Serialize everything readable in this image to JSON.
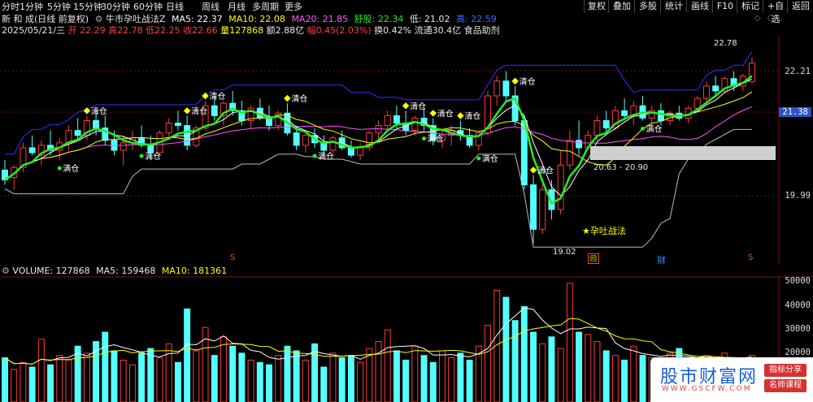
{
  "toolbar": {
    "periods": [
      "分时",
      "1分钟",
      "5分钟",
      "15分钟",
      "30分钟",
      "60分钟",
      "日线",
      "周线",
      "月线",
      "多周期",
      "更多"
    ],
    "active_period": "日线",
    "right_buttons": [
      "复权",
      "叠加",
      "多股",
      "统计",
      "画线",
      "F10",
      "标记",
      "+自选",
      "返回"
    ]
  },
  "stock": {
    "name": "新 和 成(日线 前复权)",
    "indicator": "牛市孕吐战法Z",
    "ma5": "MA5: 22.37",
    "ma10": "MA10: 22.08",
    "ma20": "MA20: 21.85",
    "sell": "舒股: 22.34",
    "low_label": "低: 21.02",
    "high_label": "高: 22.59"
  },
  "day_info": {
    "date": "2025/05/21/三",
    "open": "开 22.29",
    "high": "高22.78",
    "low": "低22.25",
    "close": "收22.66",
    "volume": "量127868",
    "amount": "额2.88亿",
    "change": "幅0.45(2.03%)",
    "turnover": "换0.42%",
    "float": "流通30.4亿",
    "sector": "食品助剂"
  },
  "price_axis": {
    "labels": [
      "22.21",
      "21.38",
      "19.99"
    ],
    "current": "21.38"
  },
  "annotations": {
    "high_mark": "22.78",
    "low_mark": "19.02",
    "range": "20.63 - 20.90",
    "pattern": "孕吐战法",
    "signal_sell": "清仓",
    "signal_buy": "满仓",
    "event_fin": "财",
    "event_s": "S"
  },
  "volume_panel": {
    "title": "VOLUME: 127868",
    "ma5": "MA5: 159468",
    "ma10": "MA10: 181361",
    "axis": [
      "50000",
      "40000",
      "30000",
      "20000"
    ]
  },
  "watermark": {
    "main": "股市财富网",
    "url": "WWW.GSCFW.COM",
    "tag1": "指标分享",
    "tag2": "名师课程"
  },
  "colors": {
    "up": "#ff3b3b",
    "down": "#54ffff",
    "ma5": "#ffffff",
    "ma10": "#ffff00",
    "ma20": "#ff55ff",
    "trend": "#22ee22",
    "band": "#3030ff",
    "signal": "#ffff00"
  },
  "chart_data": {
    "type": "candlestick",
    "volume_scale_ylim": [
      0,
      52000
    ],
    "price_ylim": [
      18.6,
      23.2
    ],
    "candles": [
      [
        20.5,
        20.7,
        20.2,
        20.3
      ],
      [
        20.35,
        20.6,
        20.1,
        20.55
      ],
      [
        20.55,
        21.05,
        20.45,
        20.95
      ],
      [
        20.95,
        21.2,
        20.8,
        20.85
      ],
      [
        20.8,
        21.1,
        20.6,
        21.0
      ],
      [
        21.0,
        21.3,
        20.8,
        20.9
      ],
      [
        20.9,
        21.15,
        20.7,
        21.05
      ],
      [
        21.05,
        21.4,
        20.9,
        21.3
      ],
      [
        21.3,
        21.55,
        21.1,
        21.2
      ],
      [
        21.2,
        21.6,
        21.1,
        21.5
      ],
      [
        21.5,
        21.7,
        21.2,
        21.35
      ],
      [
        21.35,
        21.6,
        21.0,
        21.1
      ],
      [
        21.1,
        21.3,
        20.8,
        20.9
      ],
      [
        20.9,
        21.2,
        20.6,
        21.05
      ],
      [
        21.05,
        21.3,
        20.9,
        21.15
      ],
      [
        21.15,
        21.4,
        20.95,
        21.0
      ],
      [
        21.0,
        21.2,
        20.7,
        20.85
      ],
      [
        20.85,
        21.3,
        20.8,
        21.25
      ],
      [
        21.25,
        21.55,
        21.1,
        21.45
      ],
      [
        21.45,
        21.7,
        21.3,
        21.4
      ],
      [
        21.4,
        21.6,
        20.9,
        21.0
      ],
      [
        21.0,
        21.4,
        20.95,
        21.35
      ],
      [
        21.35,
        21.9,
        21.3,
        21.8
      ],
      [
        21.8,
        22.0,
        21.5,
        21.6
      ],
      [
        21.6,
        21.9,
        21.4,
        21.85
      ],
      [
        21.85,
        22.1,
        21.6,
        21.7
      ],
      [
        21.7,
        21.9,
        21.4,
        21.5
      ],
      [
        21.5,
        21.8,
        21.35,
        21.75
      ],
      [
        21.75,
        21.95,
        21.5,
        21.55
      ],
      [
        21.55,
        21.8,
        21.3,
        21.4
      ],
      [
        21.4,
        21.7,
        21.3,
        21.65
      ],
      [
        21.65,
        21.85,
        21.2,
        21.25
      ],
      [
        21.25,
        21.4,
        20.9,
        21.0
      ],
      [
        21.0,
        21.3,
        20.85,
        21.2
      ],
      [
        21.2,
        21.35,
        20.95,
        21.05
      ],
      [
        21.05,
        21.2,
        20.8,
        20.9
      ],
      [
        20.9,
        21.2,
        20.85,
        21.15
      ],
      [
        21.15,
        21.3,
        20.9,
        20.95
      ],
      [
        20.95,
        21.1,
        20.75,
        20.8
      ],
      [
        20.8,
        21.05,
        20.7,
        20.95
      ],
      [
        20.95,
        21.3,
        20.9,
        21.25
      ],
      [
        21.25,
        21.5,
        21.1,
        21.4
      ],
      [
        21.4,
        21.7,
        21.3,
        21.6
      ],
      [
        21.6,
        21.8,
        21.35,
        21.45
      ],
      [
        21.45,
        21.7,
        21.2,
        21.3
      ],
      [
        21.3,
        21.6,
        21.2,
        21.55
      ],
      [
        21.55,
        21.75,
        21.3,
        21.4
      ],
      [
        21.4,
        21.55,
        21.0,
        21.1
      ],
      [
        21.1,
        21.3,
        20.95,
        21.2
      ],
      [
        21.2,
        21.4,
        21.0,
        21.3
      ],
      [
        21.3,
        21.5,
        21.1,
        21.2
      ],
      [
        21.2,
        21.35,
        20.95,
        21.0
      ],
      [
        21.0,
        21.3,
        20.9,
        21.25
      ],
      [
        21.25,
        22.1,
        21.2,
        22.0
      ],
      [
        22.0,
        22.4,
        21.8,
        22.3
      ],
      [
        22.3,
        22.5,
        21.9,
        22.0
      ],
      [
        22.0,
        22.2,
        21.4,
        21.5
      ],
      [
        21.5,
        21.6,
        20.1,
        20.2
      ],
      [
        20.2,
        20.4,
        19.02,
        19.3
      ],
      [
        19.3,
        20.3,
        19.2,
        20.1
      ],
      [
        20.1,
        20.3,
        19.5,
        19.7
      ],
      [
        19.7,
        20.9,
        19.6,
        20.6
      ],
      [
        20.6,
        21.3,
        20.5,
        21.1
      ],
      [
        21.1,
        21.5,
        20.8,
        20.95
      ],
      [
        20.95,
        21.3,
        20.9,
        21.2
      ],
      [
        21.2,
        21.6,
        21.1,
        21.5
      ],
      [
        21.5,
        21.7,
        21.2,
        21.35
      ],
      [
        21.35,
        21.8,
        21.3,
        21.7
      ],
      [
        21.7,
        21.95,
        21.5,
        21.6
      ],
      [
        21.6,
        21.9,
        21.4,
        21.8
      ],
      [
        21.8,
        22.0,
        21.5,
        21.55
      ],
      [
        21.55,
        21.8,
        21.4,
        21.7
      ],
      [
        21.7,
        21.85,
        21.4,
        21.5
      ],
      [
        21.5,
        21.7,
        21.4,
        21.65
      ],
      [
        21.65,
        21.8,
        21.5,
        21.55
      ],
      [
        21.55,
        21.8,
        21.45,
        21.75
      ],
      [
        21.75,
        22.0,
        21.7,
        21.95
      ],
      [
        21.95,
        22.3,
        21.9,
        22.2
      ],
      [
        22.2,
        22.4,
        22.0,
        22.1
      ],
      [
        22.1,
        22.4,
        22.05,
        22.35
      ],
      [
        22.35,
        22.5,
        22.1,
        22.2
      ],
      [
        22.2,
        22.45,
        22.1,
        22.4
      ],
      [
        22.29,
        22.78,
        22.25,
        22.66
      ]
    ],
    "volumes": [
      19000,
      14000,
      17000,
      15000,
      27000,
      16000,
      20000,
      18000,
      24000,
      21000,
      26000,
      30000,
      22000,
      18000,
      16000,
      21000,
      23000,
      19000,
      25000,
      17000,
      40000,
      22000,
      32000,
      20000,
      28000,
      24000,
      21000,
      18000,
      17000,
      16000,
      20000,
      24000,
      22000,
      18000,
      25000,
      15000,
      21000,
      19000,
      20000,
      17000,
      23000,
      26000,
      31000,
      22000,
      18000,
      24000,
      20000,
      17000,
      22000,
      19000,
      21000,
      18000,
      24000,
      33000,
      48000,
      45000,
      35000,
      41000,
      30000,
      25000,
      28000,
      23000,
      51000,
      30000,
      29000,
      26000,
      22000,
      20000,
      18000,
      24000,
      20000,
      19000,
      17000,
      21000,
      23000,
      18000,
      16000,
      20000,
      17000,
      21000,
      19000,
      18000,
      20000
    ]
  }
}
